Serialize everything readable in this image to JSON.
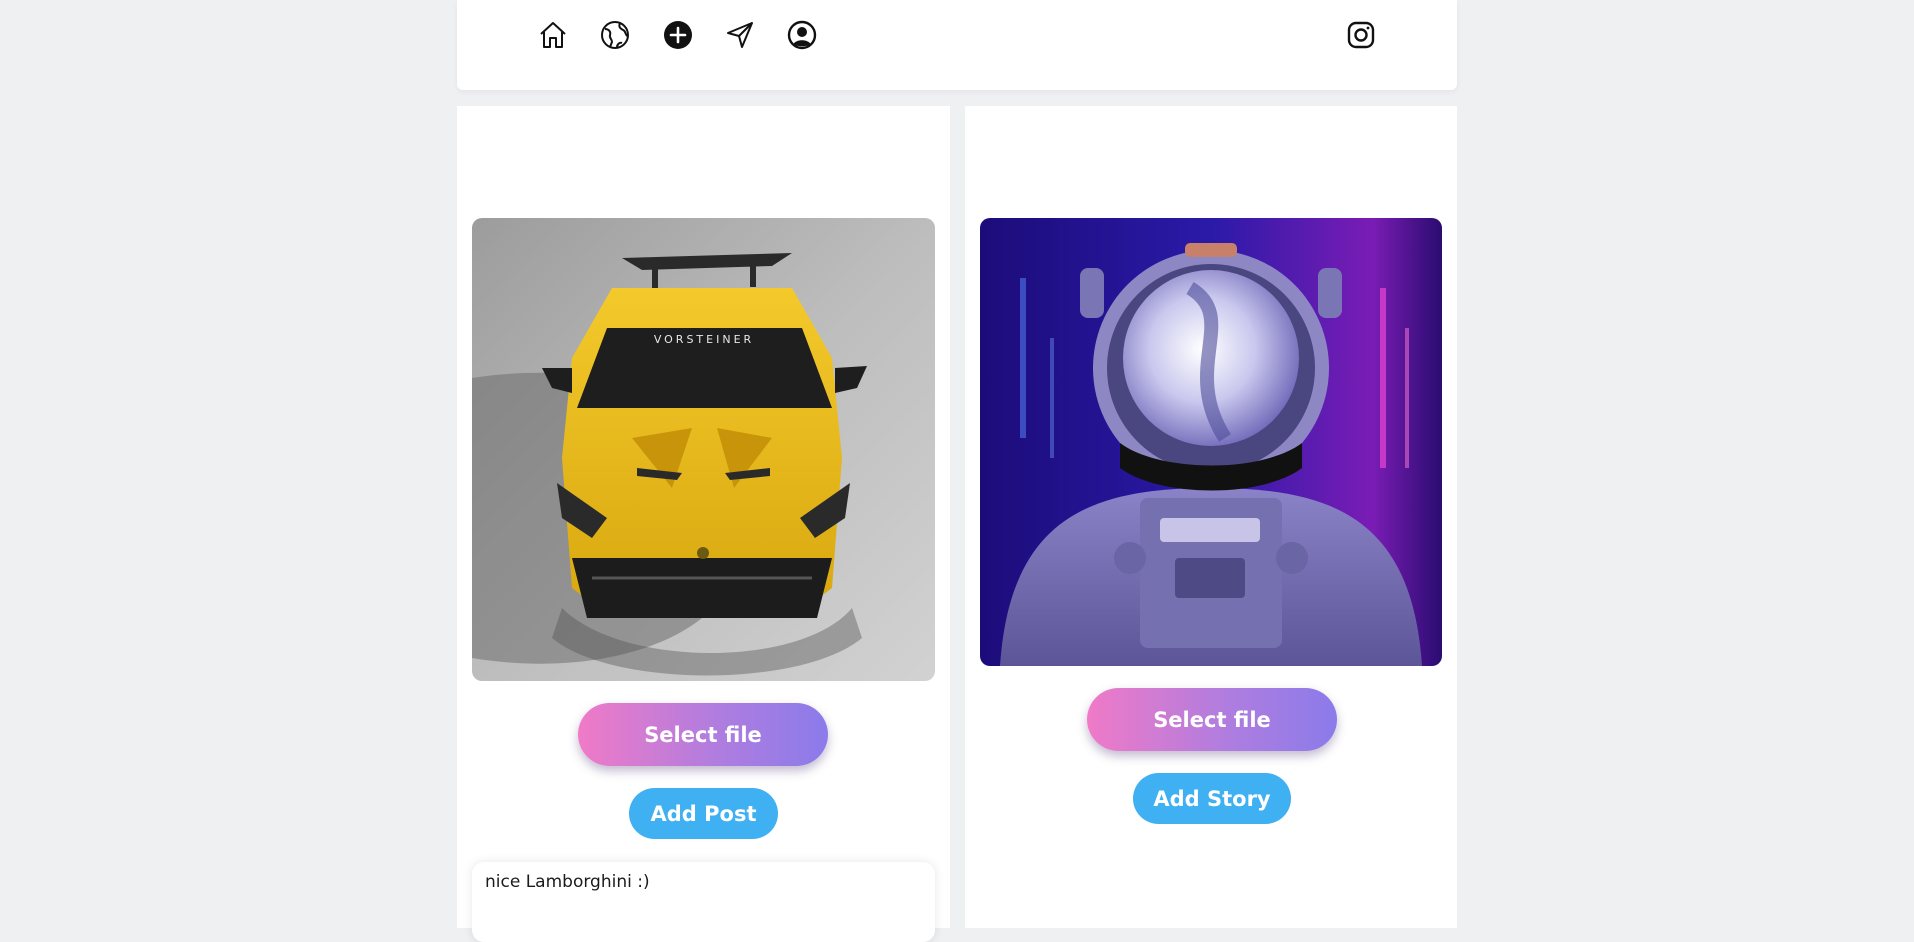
{
  "nav": {
    "icons": [
      "home-icon",
      "globe-icon",
      "add-circle-icon",
      "send-icon",
      "profile-icon"
    ],
    "brand_icon": "instagram-icon"
  },
  "post_panel": {
    "image_alt": "Yellow Lamborghini sports car",
    "select_label": "Select file",
    "submit_label": "Add Post",
    "comment": "nice Lamborghini :)"
  },
  "story_panel": {
    "image_alt": "Astronaut with neon background",
    "select_label": "Select file",
    "submit_label": "Add Story"
  },
  "colors": {
    "background": "#eff0f2",
    "select_gradient_start": "#f07ac7",
    "select_gradient_end": "#8b7bea",
    "add_button": "#3fb0f2"
  }
}
